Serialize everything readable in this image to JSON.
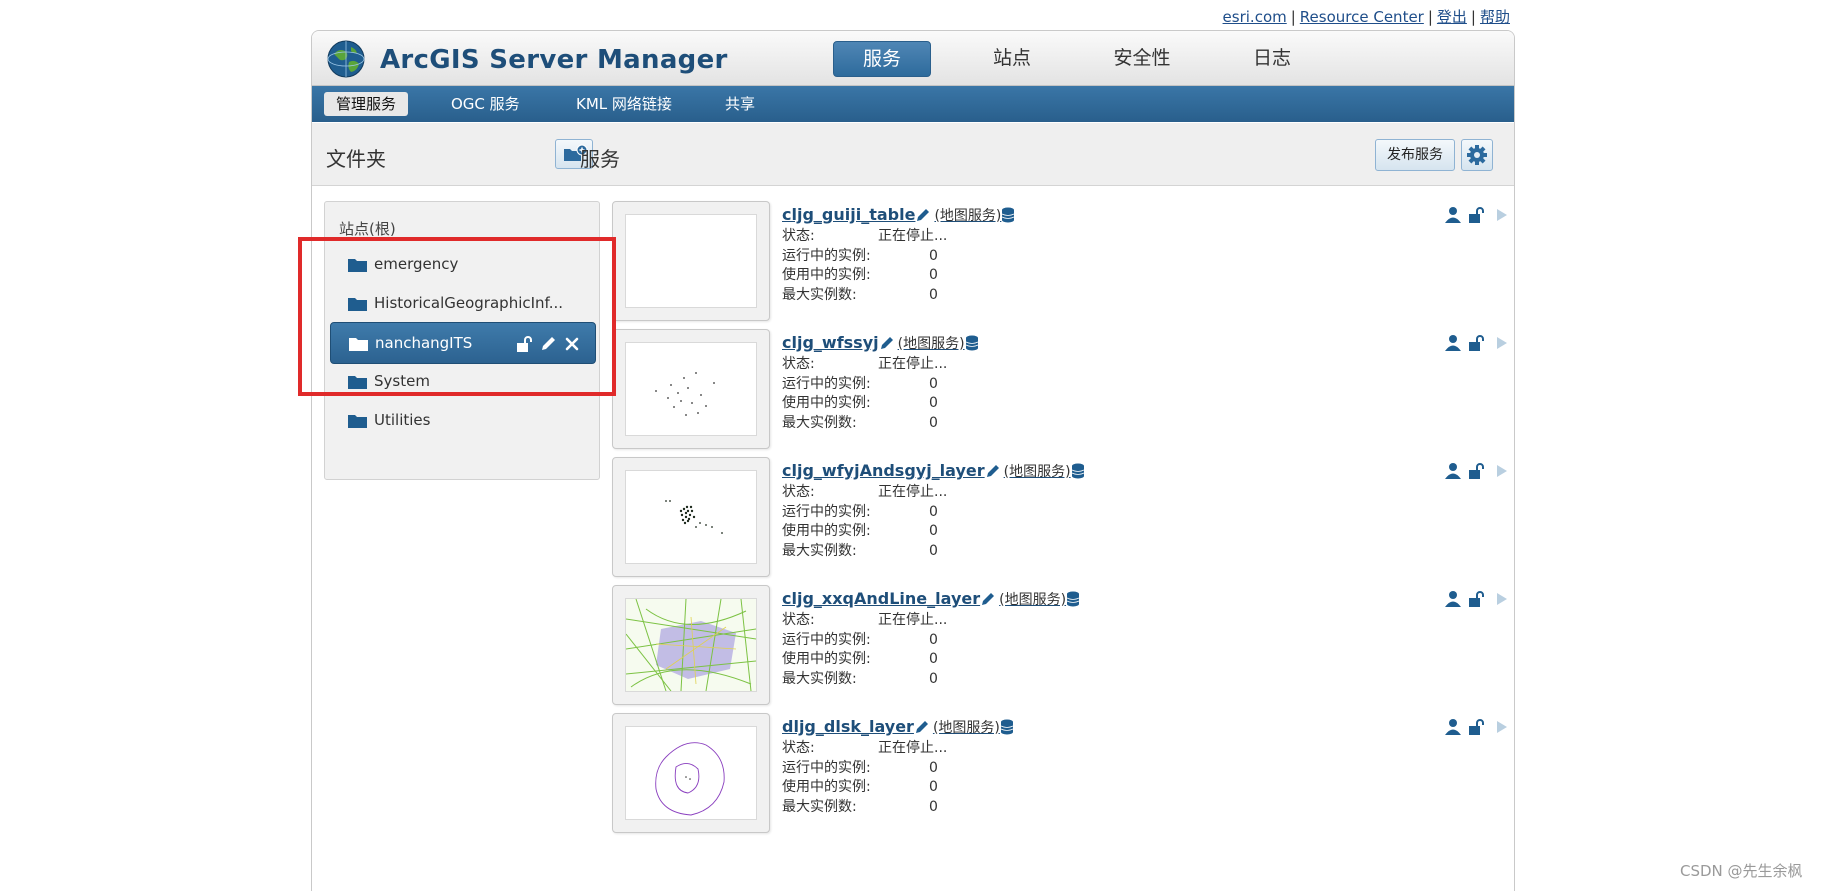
{
  "top_links": [
    {
      "label": "esri.com"
    },
    {
      "label": "Resource Center"
    },
    {
      "label": "登出"
    },
    {
      "label": "帮助"
    }
  ],
  "app": {
    "title": "ArcGIS Server Manager"
  },
  "main_tabs": [
    {
      "label": "服务",
      "active": true
    },
    {
      "label": "站点",
      "active": false
    },
    {
      "label": "安全性",
      "active": false
    },
    {
      "label": "日志",
      "active": false
    }
  ],
  "sub_tabs": [
    {
      "label": "管理服务",
      "active": true
    },
    {
      "label": "OGC 服务",
      "active": false
    },
    {
      "label": "KML 网络链接",
      "active": false
    },
    {
      "label": "共享",
      "active": false
    }
  ],
  "toolbar": {
    "folders_title": "文件夹",
    "services_title": "服务",
    "publish_label": "发布服务"
  },
  "folders": {
    "root_label": "站点(根)",
    "items": [
      {
        "label": "emergency",
        "selected": false
      },
      {
        "label": "HistoricalGeographicInf...",
        "selected": false
      },
      {
        "label": "nanchangITS",
        "selected": true
      },
      {
        "label": "System",
        "selected": false
      },
      {
        "label": "Utilities",
        "selected": false
      }
    ]
  },
  "service_labels": {
    "status": "状态:",
    "running": "运行中的实例:",
    "in_use": "使用中的实例:",
    "max": "最大实例数:"
  },
  "services": [
    {
      "name": "cljg_guiji_table",
      "type": "(地图服务)",
      "status": "正在停止...",
      "running": "0",
      "in_use": "0",
      "max": "0"
    },
    {
      "name": "cljg_wfssyj",
      "type": "(地图服务)",
      "status": "正在停止...",
      "running": "0",
      "in_use": "0",
      "max": "0"
    },
    {
      "name": "cljg_wfyjAndsgyj_layer",
      "type": "(地图服务)",
      "status": "正在停止...",
      "running": "0",
      "in_use": "0",
      "max": "0"
    },
    {
      "name": "cljg_xxqAndLine_layer",
      "type": "(地图服务)",
      "status": "正在停止...",
      "running": "0",
      "in_use": "0",
      "max": "0"
    },
    {
      "name": "dljg_dlsk_layer",
      "type": "(地图服务)",
      "status": "正在停止...",
      "running": "0",
      "in_use": "0",
      "max": "0"
    }
  ],
  "colors": {
    "accent": "#2e6b9c",
    "link": "#1e4e79",
    "highlight": "#e02a2a"
  },
  "watermark": "CSDN @先生余枫"
}
